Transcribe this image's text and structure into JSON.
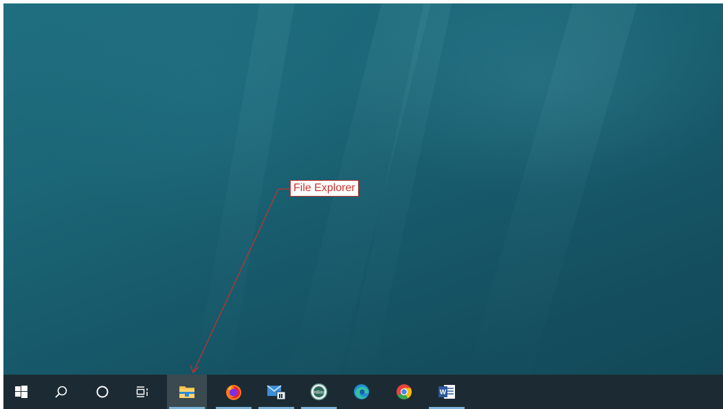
{
  "annotation": {
    "label": "File Explorer",
    "color": "#c9302c"
  },
  "taskbar": {
    "items": [
      {
        "name": "start-button",
        "icon": "windows-logo-icon",
        "active": false,
        "running": false
      },
      {
        "name": "search-button",
        "icon": "search-icon",
        "active": false,
        "running": false
      },
      {
        "name": "cortana-button",
        "icon": "cortana-circle-icon",
        "active": false,
        "running": false
      },
      {
        "name": "task-view-button",
        "icon": "task-view-icon",
        "active": false,
        "running": false
      },
      {
        "name": "file-explorer-button",
        "icon": "file-explorer-folder-icon",
        "active": true,
        "running": true
      },
      {
        "name": "firefox-button",
        "icon": "firefox-icon",
        "active": false,
        "running": true
      },
      {
        "name": "mail-button",
        "icon": "mail-icon",
        "active": false,
        "running": true
      },
      {
        "name": "onbase-button",
        "icon": "onbase-icon",
        "label": "OnBase",
        "active": false,
        "running": true
      },
      {
        "name": "edge-button",
        "icon": "edge-icon",
        "active": false,
        "running": false
      },
      {
        "name": "chrome-button",
        "icon": "chrome-icon",
        "active": false,
        "running": false
      },
      {
        "name": "word-button",
        "icon": "word-icon",
        "label": "W",
        "active": false,
        "running": true
      }
    ],
    "colors": {
      "background": "#1c2b33",
      "active_background": "#3b4950",
      "running_indicator": "#7eb4dc"
    }
  },
  "desktop": {
    "wallpaper_color": "#175a6b"
  }
}
